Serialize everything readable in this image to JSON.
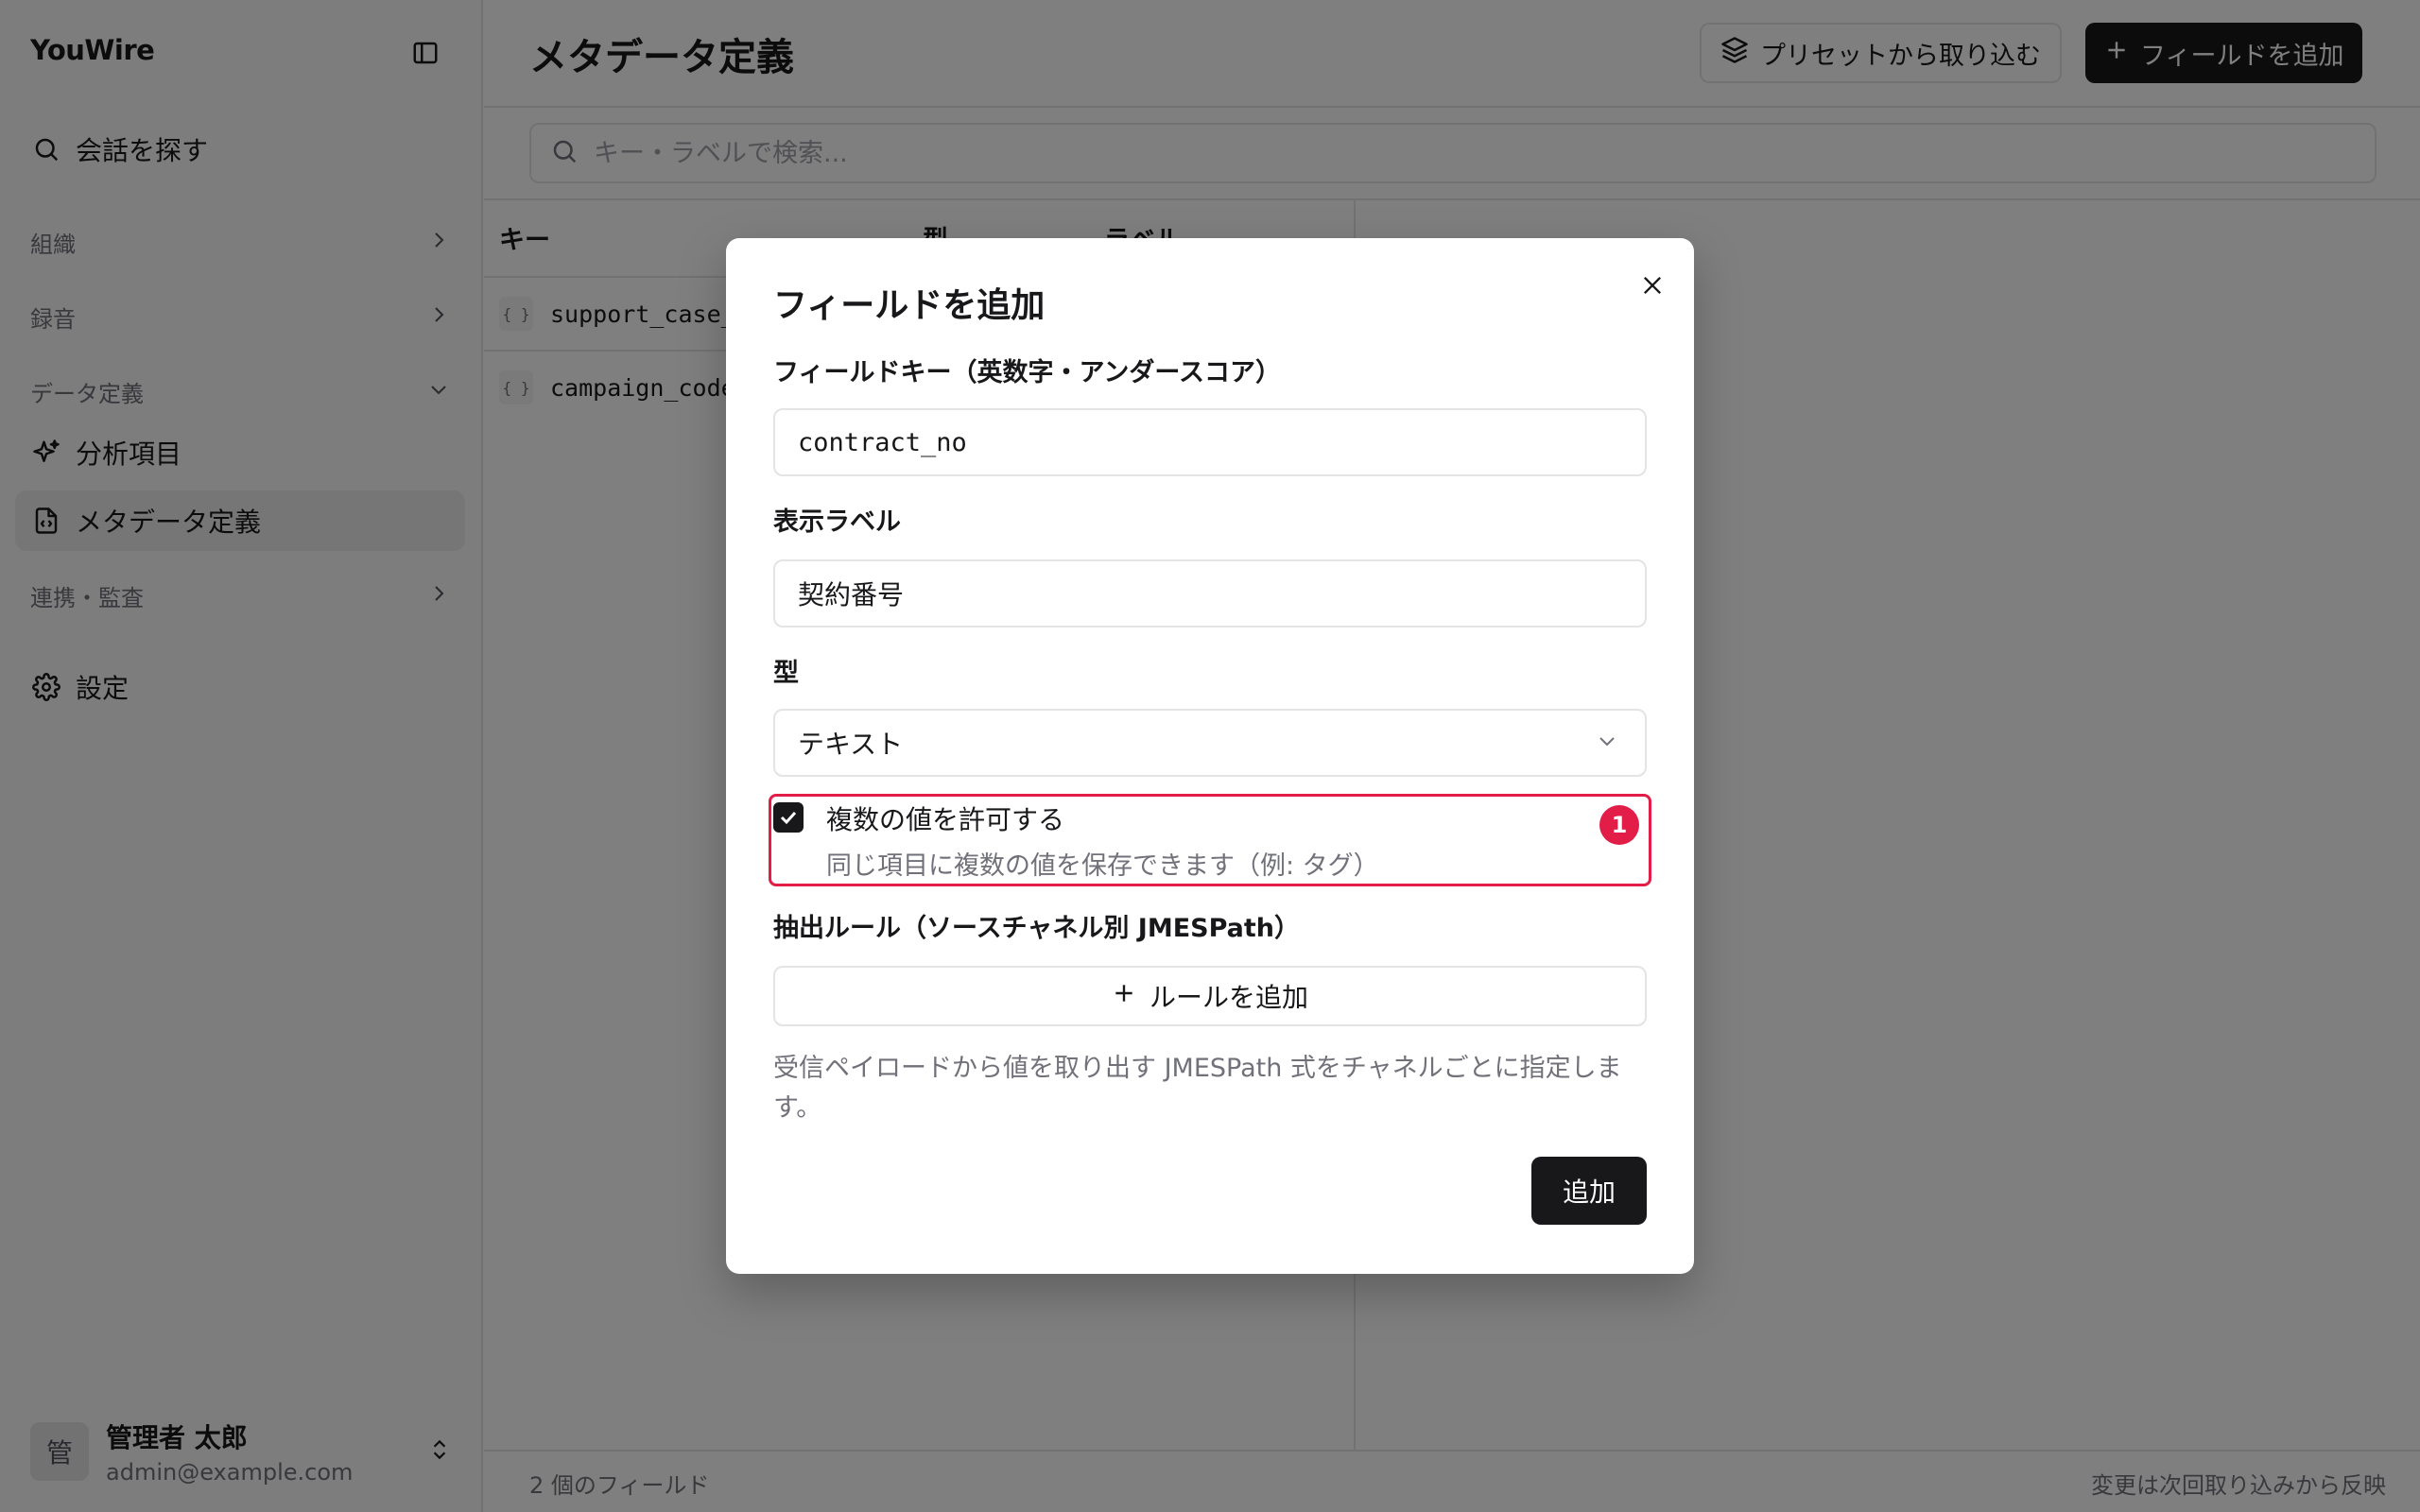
{
  "sidebar": {
    "brand": "YouWire",
    "search_label": "会話を探す",
    "groups": {
      "org": "組織",
      "recording": "録音",
      "data_def": "データ定義",
      "integration": "連携・監査"
    },
    "items": {
      "analysis": "分析項目",
      "metadata": "メタデータ定義",
      "settings": "設定"
    },
    "user": {
      "avatar_char": "管",
      "name": "管理者 太郎",
      "email": "admin@example.com"
    }
  },
  "header": {
    "title": "メタデータ定義",
    "import_button": "プリセットから取り込む",
    "add_button": "フィールドを追加"
  },
  "search": {
    "placeholder": "キー・ラベルで検索..."
  },
  "table": {
    "columns": [
      "キー",
      "型",
      "ラベル"
    ],
    "rows": [
      {
        "key": "support_case_"
      },
      {
        "key": "campaign_code"
      }
    ]
  },
  "footer": {
    "count": "2 個のフィールド",
    "note": "変更は次回取り込みから反映"
  },
  "modal": {
    "title": "フィールドを追加",
    "key_label": "フィールドキー（英数字・アンダースコア）",
    "key_value": "contract_no",
    "display_label": "表示ラベル",
    "display_value": "契約番号",
    "type_label": "型",
    "type_value": "テキスト",
    "multi_label": "複数の値を許可する",
    "multi_desc": "同じ項目に複数の値を保存できます（例: タグ）",
    "multi_checked": true,
    "badge": "1",
    "rules_label": "抽出ルール（ソースチャネル別 JMESPath）",
    "add_rule": "ルールを追加",
    "hint": "受信ペイロードから値を取り出す JMESPath 式をチャネルごとに指定します。",
    "submit": "追加"
  },
  "colors": {
    "accent": "#18181b",
    "highlight": "#e11d48",
    "overlay": "rgba(0,0,0,0.5)"
  }
}
